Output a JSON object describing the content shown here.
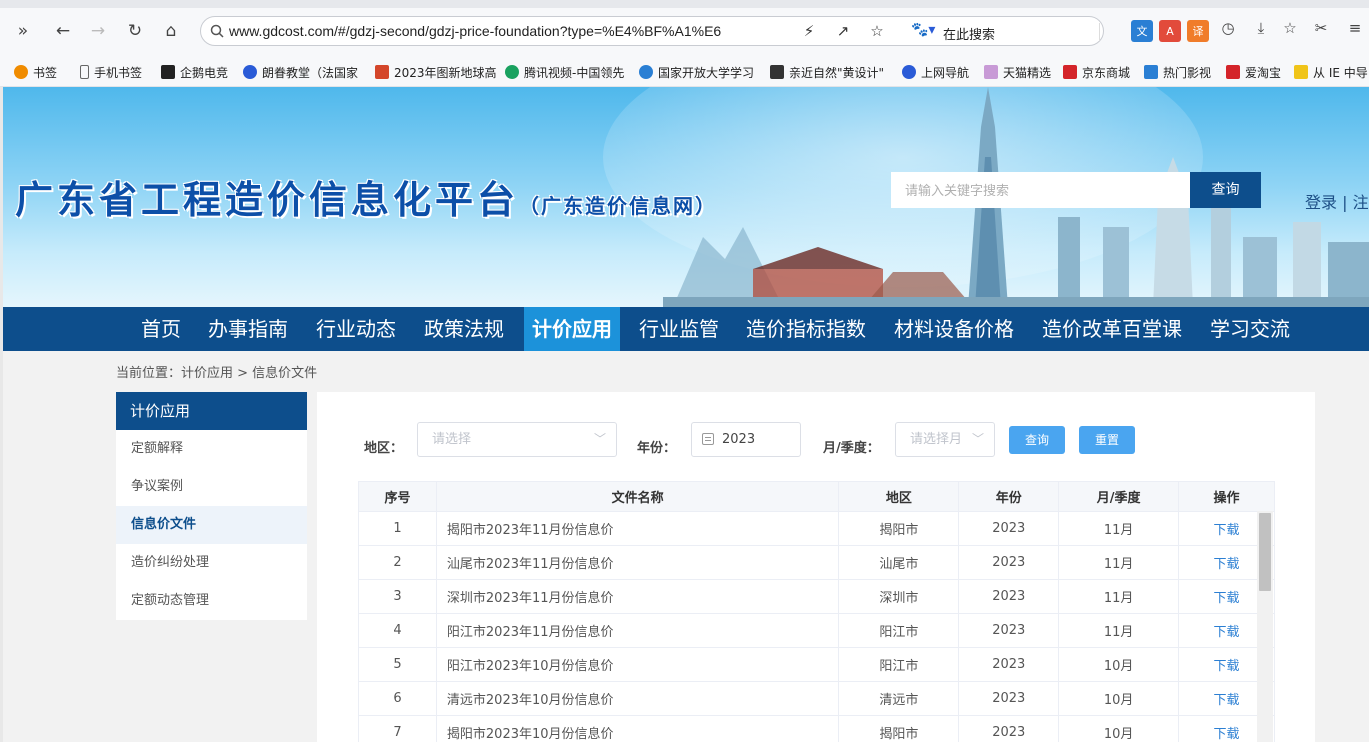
{
  "browser": {
    "url": "www.gdcost.com/#/gdzj-second/gdzj-price-foundation?type=%E4%BF%A1%E6",
    "search_engine_placeholder": "在此搜索",
    "bookmarks": [
      {
        "label": "书签",
        "icon": "star-icon",
        "color": "#f08c00"
      },
      {
        "label": "手机书签",
        "icon": "phone-icon",
        "color": "#666666"
      },
      {
        "label": "企鹅电竞",
        "icon": "penguin-icon",
        "color": "#222222"
      },
      {
        "label": "朗眷教堂（法国家",
        "icon": "paw-icon",
        "color": "#2a5bd7"
      },
      {
        "label": "2023年图新地球高",
        "icon": "globe-icon",
        "color": "#d4462a"
      },
      {
        "label": "腾讯视频-中国领先",
        "icon": "play-icon",
        "color": "#19a15f"
      },
      {
        "label": "国家开放大学学习",
        "icon": "edu-icon",
        "color": "#2a7fd4"
      },
      {
        "label": "亲近自然\"黄设计\"",
        "icon": "leaf-icon",
        "color": "#333333"
      },
      {
        "label": "上网导航",
        "icon": "nav-icon",
        "color": "#2a5bd7"
      },
      {
        "label": "天猫精选",
        "icon": "tmall-icon",
        "color": "#c89ad6"
      },
      {
        "label": "京东商城",
        "icon": "jd-icon",
        "color": "#d4242a"
      },
      {
        "label": "热门影视",
        "icon": "tv-icon",
        "color": "#2a7fd4"
      },
      {
        "label": "爱淘宝",
        "icon": "taobao-icon",
        "color": "#d4242a"
      },
      {
        "label": "从 IE 中导",
        "icon": "folder-icon",
        "color": "#f0c419"
      }
    ]
  },
  "site": {
    "title": "广东省工程造价信息化平台",
    "subtitle": "（广东造价信息网）",
    "search_placeholder": "请输入关键字搜索",
    "search_button": "查询",
    "login": "登录 | 注"
  },
  "nav": {
    "items": [
      "首页",
      "办事指南",
      "行业动态",
      "政策法规",
      "计价应用",
      "行业监管",
      "造价指标指数",
      "材料设备价格",
      "造价改革百堂课",
      "学习交流"
    ],
    "active_index": 4
  },
  "breadcrumb": "当前位置：计价应用 > 信息价文件",
  "sidebar": {
    "title": "计价应用",
    "items": [
      "定额解释",
      "争议案例",
      "信息价文件",
      "造价纠纷处理",
      "定额动态管理"
    ],
    "active_index": 2
  },
  "filters": {
    "region_label": "地区：",
    "region_placeholder": "请选择",
    "year_label": "年份：",
    "year_value": "2023",
    "period_label": "月/季度：",
    "period_placeholder": "请选择月",
    "query_button": "查询",
    "reset_button": "重置"
  },
  "table": {
    "columns": [
      "序号",
      "文件名称",
      "地区",
      "年份",
      "月/季度",
      "操作"
    ],
    "rows": [
      {
        "no": "1",
        "name": "揭阳市2023年11月份信息价",
        "region": "揭阳市",
        "year": "2023",
        "period": "11月",
        "action": "下载"
      },
      {
        "no": "2",
        "name": "汕尾市2023年11月份信息价",
        "region": "汕尾市",
        "year": "2023",
        "period": "11月",
        "action": "下载"
      },
      {
        "no": "3",
        "name": "深圳市2023年11月份信息价",
        "region": "深圳市",
        "year": "2023",
        "period": "11月",
        "action": "下载"
      },
      {
        "no": "4",
        "name": "阳江市2023年11月份信息价",
        "region": "阳江市",
        "year": "2023",
        "period": "11月",
        "action": "下载"
      },
      {
        "no": "5",
        "name": "阳江市2023年10月份信息价",
        "region": "阳江市",
        "year": "2023",
        "period": "10月",
        "action": "下载"
      },
      {
        "no": "6",
        "name": "清远市2023年10月份信息价",
        "region": "清远市",
        "year": "2023",
        "period": "10月",
        "action": "下载"
      },
      {
        "no": "7",
        "name": "揭阳市2023年10月份信息价",
        "region": "揭阳市",
        "year": "2023",
        "period": "10月",
        "action": "下载"
      }
    ]
  },
  "colors": {
    "brand_dark": "#0d4e8c",
    "nav_active": "#1c92da",
    "button": "#4aa5f0",
    "link": "#2b7fd3"
  }
}
